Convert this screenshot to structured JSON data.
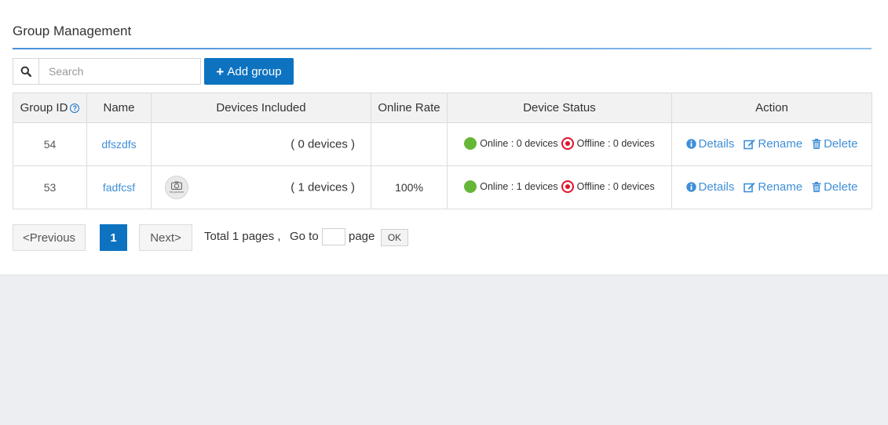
{
  "page": {
    "title": "Group Management"
  },
  "toolbar": {
    "search_placeholder": "Search",
    "add_label": "Add group"
  },
  "table": {
    "headers": {
      "group_id": "Group ID",
      "name": "Name",
      "devices": "Devices Included",
      "online_rate": "Online Rate",
      "status": "Device Status",
      "action": "Action"
    },
    "rows": [
      {
        "id": "54",
        "name": "dfszdfs",
        "has_picture": false,
        "devices": "( 0 devices )",
        "online_rate": "",
        "online": "Online : 0 devices",
        "offline": "Offline : 0 devices"
      },
      {
        "id": "53",
        "name": "fadfcsf",
        "has_picture": true,
        "picture_label": "No picture",
        "devices": "( 1 devices )",
        "online_rate": "100%",
        "online": "Online : 1 devices",
        "offline": "Offline : 0 devices"
      }
    ],
    "actions": {
      "details": "Details",
      "rename": "Rename",
      "delete": "Delete"
    }
  },
  "pagination": {
    "previous": "<Previous",
    "current": "1",
    "next": "Next>",
    "total": "Total 1 pages ,",
    "goto": "Go to",
    "page_label": "page",
    "ok": "OK"
  },
  "colors": {
    "primary": "#0d72c0",
    "link": "#3f8fd8",
    "online": "#66b638",
    "offline": "#e0112b"
  }
}
